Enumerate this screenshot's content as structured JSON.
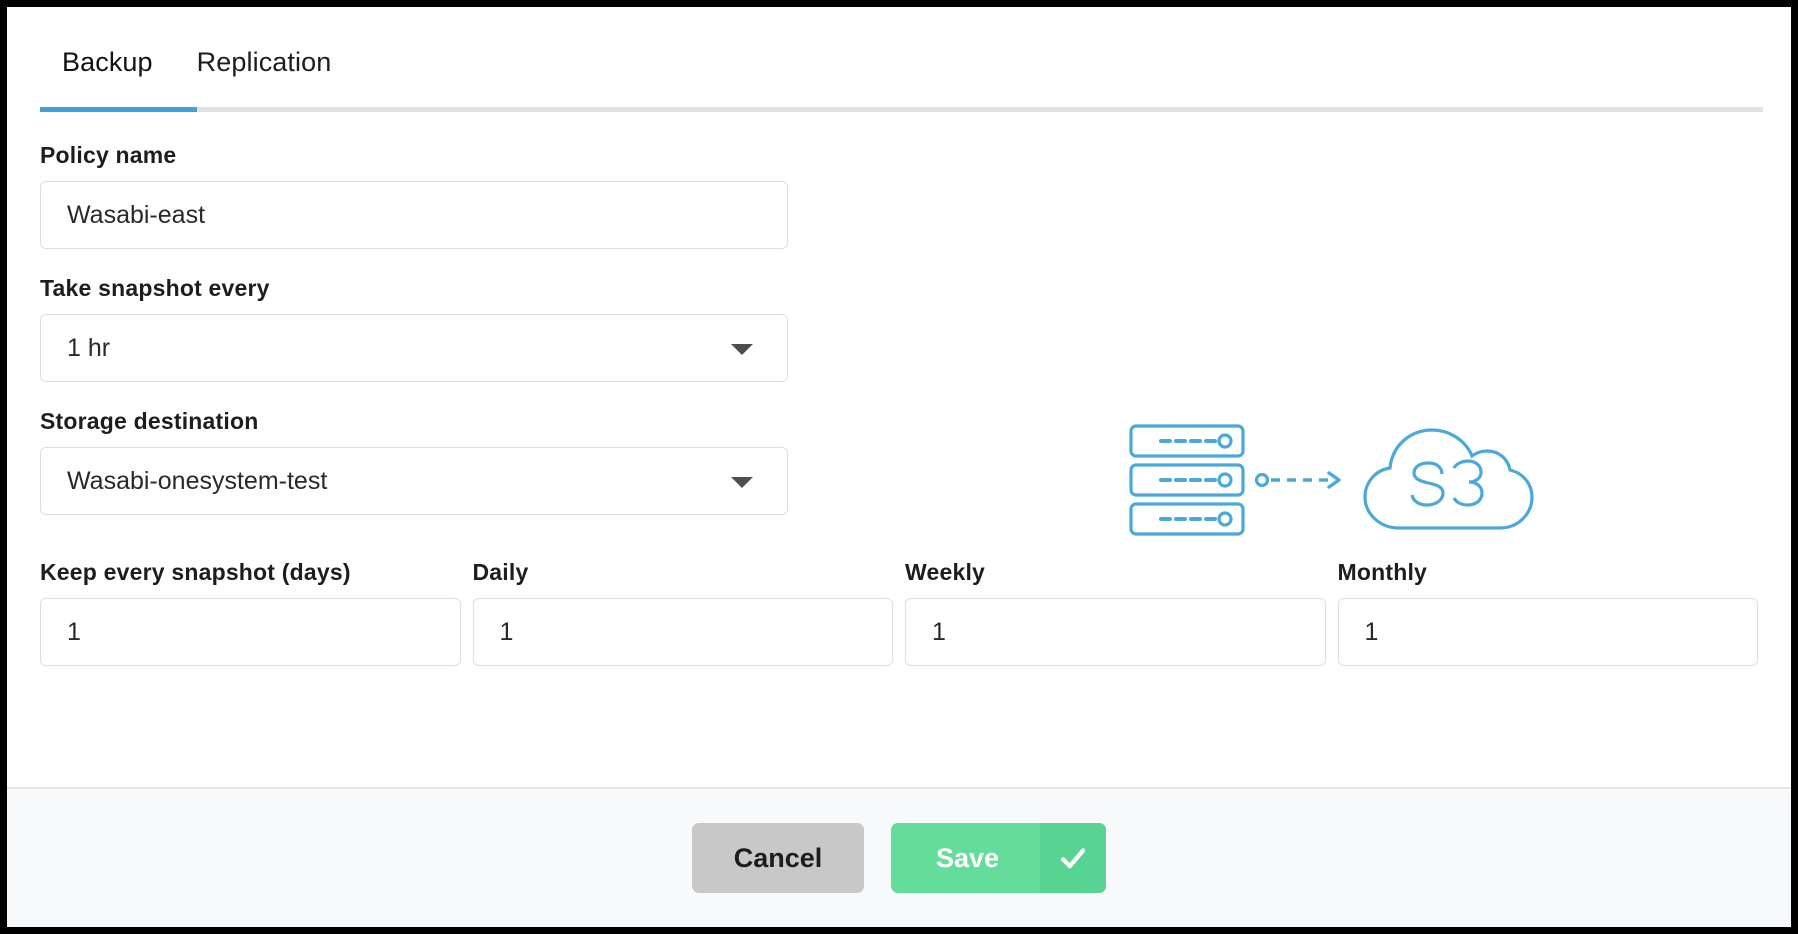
{
  "tabs": [
    {
      "id": "backup",
      "label": "Backup",
      "active": true
    },
    {
      "id": "replication",
      "label": "Replication",
      "active": false
    }
  ],
  "form": {
    "policy_name": {
      "label": "Policy name",
      "value": "Wasabi-east",
      "placeholder": ""
    },
    "snapshot_interval": {
      "label": "Take snapshot every",
      "value": "1 hr"
    },
    "storage_destination": {
      "label": "Storage destination",
      "value": "Wasabi-onesystem-test"
    },
    "retention": [
      {
        "label": "Keep every snapshot (days)",
        "value": "1"
      },
      {
        "label": "Daily",
        "value": "1"
      },
      {
        "label": "Weekly",
        "value": "1"
      },
      {
        "label": "Monthly",
        "value": "1"
      }
    ]
  },
  "illustration": {
    "name": "server-to-s3-cloud-illustration",
    "cloud_label": "S3",
    "color": "#4aa8da"
  },
  "footer": {
    "cancel_label": "Cancel",
    "save_label": "Save"
  },
  "colors": {
    "accent_blue": "#3fa2d4",
    "save_green": "#64dd9b",
    "save_green_dark": "#57d392",
    "cancel_gray": "#c8c8c8",
    "footer_bg": "#f7f9fb",
    "border_gray": "#dcdfe2"
  }
}
